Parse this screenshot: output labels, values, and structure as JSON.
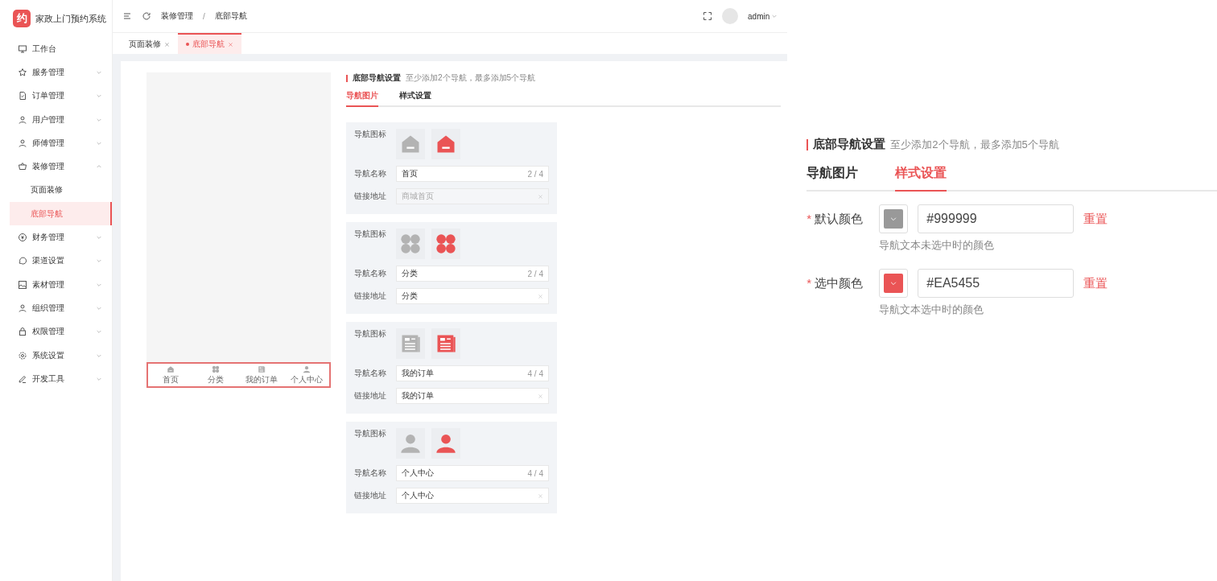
{
  "app": {
    "logo_mark": "约",
    "title": "家政上门预约系统"
  },
  "sidebar": {
    "items": [
      {
        "label": "工作台",
        "kind": "monitor",
        "expandable": false,
        "expanded": false,
        "selected": false
      },
      {
        "label": "服务管理",
        "kind": "star",
        "expandable": true,
        "expanded": false,
        "selected": false
      },
      {
        "label": "订单管理",
        "kind": "doc",
        "expandable": true,
        "expanded": false,
        "selected": false
      },
      {
        "label": "用户管理",
        "kind": "user",
        "expandable": true,
        "expanded": false,
        "selected": false
      },
      {
        "label": "师傅管理",
        "kind": "user",
        "expandable": true,
        "expanded": false,
        "selected": false
      },
      {
        "label": "装修管理",
        "kind": "cart",
        "expandable": true,
        "expanded": true,
        "selected": false,
        "children": [
          {
            "label": "页面装修",
            "selected": false
          },
          {
            "label": "底部导航",
            "selected": true
          }
        ]
      },
      {
        "label": "财务管理",
        "kind": "coin",
        "expandable": true,
        "expanded": false,
        "selected": false
      },
      {
        "label": "渠道设置",
        "kind": "chat",
        "expandable": true,
        "expanded": false,
        "selected": false
      },
      {
        "label": "素材管理",
        "kind": "image",
        "expandable": true,
        "expanded": false,
        "selected": false
      },
      {
        "label": "组织管理",
        "kind": "user",
        "expandable": true,
        "expanded": false,
        "selected": false
      },
      {
        "label": "权限管理",
        "kind": "lock",
        "expandable": true,
        "expanded": false,
        "selected": false
      },
      {
        "label": "系统设置",
        "kind": "gear",
        "expandable": true,
        "expanded": false,
        "selected": false
      },
      {
        "label": "开发工具",
        "kind": "pen",
        "expandable": true,
        "expanded": false,
        "selected": false
      }
    ]
  },
  "header": {
    "breadcrumb": [
      "装修管理",
      "底部导航"
    ],
    "separator": "/",
    "user": "admin"
  },
  "tabs": [
    {
      "label": "页面装修",
      "selected": false
    },
    {
      "label": "底部导航",
      "selected": true
    }
  ],
  "preview": {
    "nav": [
      {
        "label": "首页",
        "kind": "home"
      },
      {
        "label": "分类",
        "kind": "category"
      },
      {
        "label": "我的订单",
        "kind": "order"
      },
      {
        "label": "个人中心",
        "kind": "user"
      }
    ]
  },
  "settings": {
    "title": "底部导航设置",
    "hint": "至少添加2个导航，最多添加5个导航",
    "tabs": [
      {
        "label": "导航图片",
        "selected": true
      },
      {
        "label": "样式设置",
        "selected": false
      }
    ],
    "nav_items": [
      {
        "kind": "home",
        "icon_label": "导航图标",
        "name_label": "导航名称",
        "name": "首页",
        "count": "2 / 4",
        "link_label": "链接地址",
        "link": "商城首页",
        "link_disabled": true
      },
      {
        "kind": "category",
        "icon_label": "导航图标",
        "name_label": "导航名称",
        "name": "分类",
        "count": "2 / 4",
        "link_label": "链接地址",
        "link": "分类",
        "link_disabled": false
      },
      {
        "kind": "order",
        "icon_label": "导航图标",
        "name_label": "导航名称",
        "name": "我的订单",
        "count": "4 / 4",
        "link_label": "链接地址",
        "link": "我的订单",
        "link_disabled": false
      },
      {
        "kind": "user",
        "icon_label": "导航图标",
        "name_label": "导航名称",
        "name": "个人中心",
        "count": "4 / 4",
        "link_label": "链接地址",
        "link": "个人中心",
        "link_disabled": false
      }
    ]
  },
  "inset": {
    "title": "底部导航设置",
    "hint": "至少添加2个导航，最多添加5个导航",
    "tabs": [
      {
        "label": "导航图片",
        "selected": false
      },
      {
        "label": "样式设置",
        "selected": true
      }
    ],
    "colors": [
      {
        "label": "默认颜色",
        "required": true,
        "required_mark": "*",
        "color": "#999999",
        "value": "#999999",
        "reset": "重置",
        "help": "导航文本未选中时的颜色"
      },
      {
        "label": "选中颜色",
        "required": true,
        "required_mark": "*",
        "color": "#ea5455",
        "value": "#EA5455",
        "reset": "重置",
        "help": "导航文本选中时的颜色"
      }
    ]
  }
}
